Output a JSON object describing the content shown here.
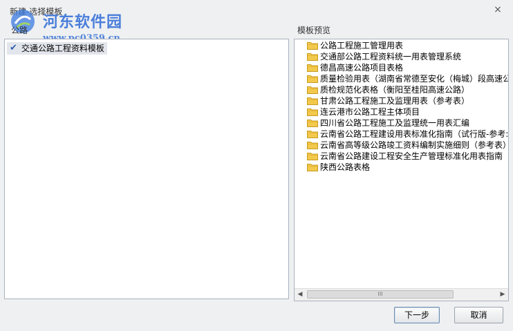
{
  "window": {
    "title": "新建-选择模板",
    "close_glyph": "×"
  },
  "watermark": {
    "text": "河东软件园",
    "url": "www.pc0359.cn"
  },
  "left_panel": {
    "header": "公路",
    "items": [
      {
        "label": "交通公路工程资料模板",
        "checked": true
      }
    ]
  },
  "right_panel": {
    "header": "模板预览",
    "items": [
      {
        "label": "公路工程施工管理用表",
        "icon": "folder-icon"
      },
      {
        "label": "交通部公路工程资料统一用表管理系统",
        "icon": "folder-icon"
      },
      {
        "label": "德昌高速公路项目表格",
        "icon": "folder-icon"
      },
      {
        "label": "质量检验用表（湖南省常德至安化（梅城）段高速公",
        "icon": "folder-icon"
      },
      {
        "label": "质检规范化表格（衡阳至桂阳高速公路）",
        "icon": "folder-icon"
      },
      {
        "label": "甘肃公路工程施工及监理用表（参考表）",
        "icon": "folder-icon"
      },
      {
        "label": "连云港市公路工程主体项目",
        "icon": "folder-icon"
      },
      {
        "label": "四川省公路工程施工及监理统一用表汇编",
        "icon": "folder-icon"
      },
      {
        "label": "云南省公路工程建设用表标准化指南（试行版-参考:",
        "icon": "folder-icon"
      },
      {
        "label": "云南省高等级公路竣工资料编制实施细则（参考表）",
        "icon": "folder-icon"
      },
      {
        "label": "云南省公路建设工程安全生产管理标准化用表指南",
        "icon": "folder-icon"
      },
      {
        "label": "陕西公路表格",
        "icon": "folder-icon"
      }
    ],
    "scrollbar": {
      "left_arrow": "◀",
      "right_arrow": "▶",
      "thumb_grip": "III"
    }
  },
  "buttons": {
    "next": "下一步",
    "cancel": "取消"
  },
  "colors": {
    "accent": "#2e6bd6",
    "folder": "#f2c94c",
    "selection": "#e2e6ec"
  }
}
